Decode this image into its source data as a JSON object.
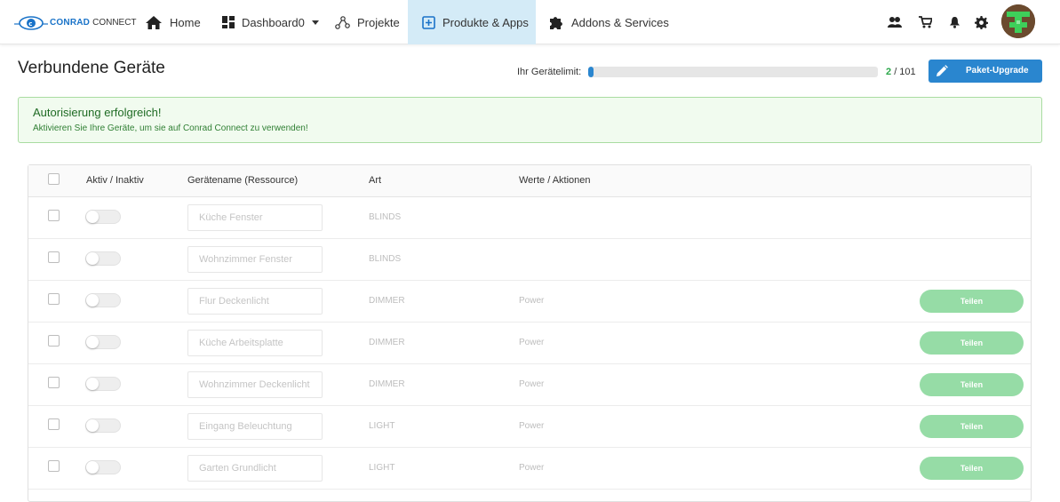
{
  "nav": {
    "brand_main": "CONRAD",
    "brand_sub": "CONNECT",
    "home": "Home",
    "dashboard": "Dashboard0",
    "projects": "Projekte",
    "products": "Produkte & Apps",
    "addons": "Addons & Services"
  },
  "page": {
    "title": "Verbundene Geräte",
    "limit_label": "Ihr Gerätelimit:",
    "limit_used": "2",
    "limit_total": "/ 101",
    "limit_fraction": 0.0198,
    "upgrade_label": "Paket-Upgrade"
  },
  "alert": {
    "title": "Autorisierung erfolgreich!",
    "text": "Aktivieren Sie Ihre Geräte, um sie auf Conrad Connect zu verwenden!"
  },
  "table": {
    "headers": {
      "active": "Aktiv / Inaktiv",
      "name": "Gerätename (Ressource)",
      "type": "Art",
      "values": "Werte / Aktionen"
    },
    "share_label": "Teilen",
    "rows": [
      {
        "name": "Küche Fenster",
        "type": "BLINDS",
        "value": "",
        "share": false
      },
      {
        "name": "Wohnzimmer Fenster",
        "type": "BLINDS",
        "value": "",
        "share": false
      },
      {
        "name": "Flur Deckenlicht",
        "type": "DIMMER",
        "value": "Power",
        "share": true
      },
      {
        "name": "Küche Arbeitsplatte",
        "type": "DIMMER",
        "value": "Power",
        "share": true
      },
      {
        "name": "Wohnzimmer Deckenlicht",
        "type": "DIMMER",
        "value": "Power",
        "share": true
      },
      {
        "name": "Eingang Beleuchtung",
        "type": "LIGHT",
        "value": "Power",
        "share": true
      },
      {
        "name": "Garten Grundlicht",
        "type": "LIGHT",
        "value": "Power",
        "share": true
      }
    ]
  },
  "colors": {
    "primary": "#2a86cf",
    "nav_active_bg": "#d4ebf7",
    "success": "#2ba84a",
    "share_button": "#96dca6"
  }
}
